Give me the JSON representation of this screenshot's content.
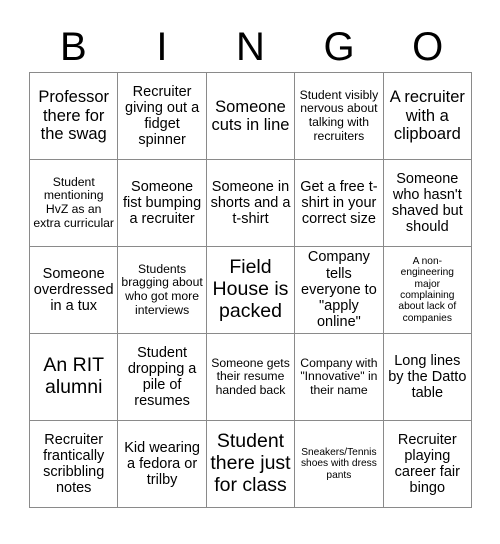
{
  "header": {
    "letters": [
      "B",
      "I",
      "N",
      "G",
      "O"
    ]
  },
  "grid": {
    "rows": 5,
    "columns": 5,
    "cells": [
      {
        "text": "Professor there for the swag",
        "size": "lg"
      },
      {
        "text": "Recruiter giving out a fidget spinner",
        "size": "md"
      },
      {
        "text": "Someone cuts in line",
        "size": "lg"
      },
      {
        "text": "Student visibly nervous about talking with recruiters",
        "size": "sm"
      },
      {
        "text": "A recruiter with a clipboard",
        "size": "lg"
      },
      {
        "text": "Student mentioning HvZ as an extra curricular",
        "size": "sm"
      },
      {
        "text": "Someone fist bumping a recruiter",
        "size": "md"
      },
      {
        "text": "Someone in shorts and a t-shirt",
        "size": "md"
      },
      {
        "text": "Get a free t-shirt in your correct size",
        "size": "md"
      },
      {
        "text": "Someone who hasn't shaved but should",
        "size": "md"
      },
      {
        "text": "Someone overdressed in a tux",
        "size": "md"
      },
      {
        "text": "Students bragging about who got more interviews",
        "size": "sm"
      },
      {
        "text": "Field House is packed",
        "size": "xl"
      },
      {
        "text": "Company tells everyone to \"apply online\"",
        "size": "md"
      },
      {
        "text": "A non-engineering major complaining about lack of companies",
        "size": "xs"
      },
      {
        "text": "An RIT alumni",
        "size": "xl"
      },
      {
        "text": "Student dropping a pile of resumes",
        "size": "md"
      },
      {
        "text": "Someone gets their resume handed back",
        "size": "sm"
      },
      {
        "text": "Company with \"Innovative\" in their name",
        "size": "sm"
      },
      {
        "text": "Long lines by the Datto table",
        "size": "md"
      },
      {
        "text": "Recruiter frantically scribbling notes",
        "size": "md"
      },
      {
        "text": "Kid wearing a fedora or trilby",
        "size": "md"
      },
      {
        "text": "Student there just for class",
        "size": "xl"
      },
      {
        "text": "Sneakers/Tennis shoes with dress pants",
        "size": "xs"
      },
      {
        "text": "Recruiter playing career fair bingo",
        "size": "md"
      }
    ]
  }
}
